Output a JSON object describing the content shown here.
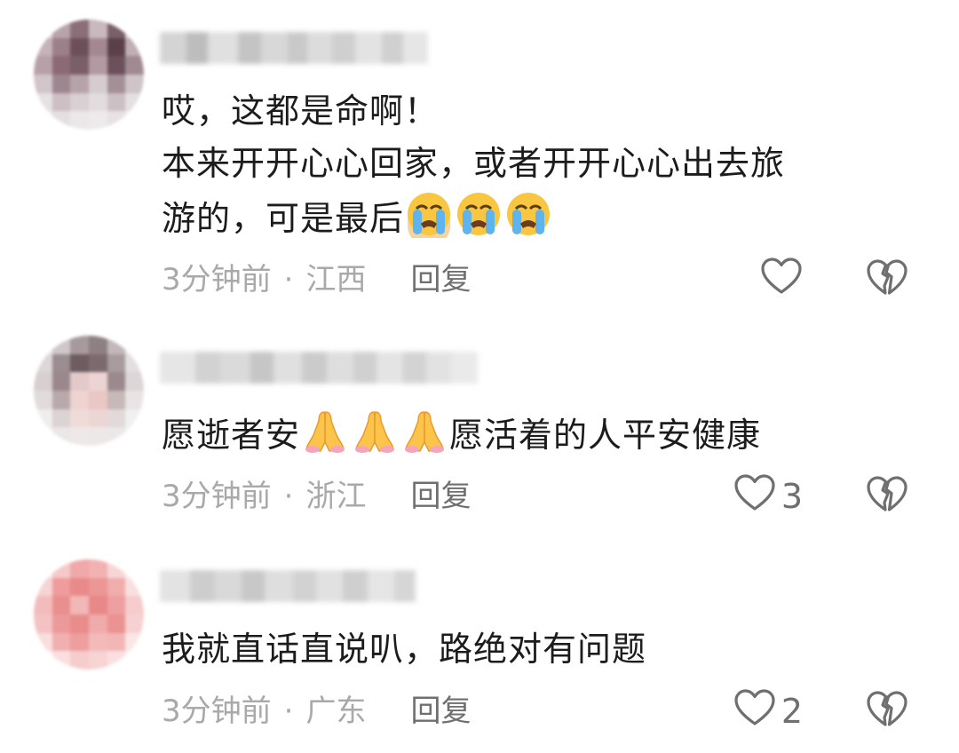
{
  "comments": [
    {
      "text_lines": [
        "哎，这都是命啊！",
        "本来开开心心回家，或者开开心心出去旅",
        "游的，可是最后"
      ],
      "time": "3分钟前",
      "separator": "·",
      "location": "江西",
      "reply_label": "回复",
      "likes": null,
      "emoji": "loudly-crying-face",
      "emoji_count": 3
    },
    {
      "text_before": "愿逝者安",
      "text_after": "愿活着的人平安健康",
      "time": "3分钟前",
      "separator": "·",
      "location": "浙江",
      "reply_label": "回复",
      "likes": "3",
      "emoji": "folded-hands",
      "emoji_count": 3
    },
    {
      "text": "我就直话直说叭，路绝对有问题",
      "time": "3分钟前",
      "separator": "·",
      "location": "广东",
      "reply_label": "回复",
      "likes": "2"
    }
  ],
  "icons": {
    "like": "heart-outline-icon",
    "dislike": "broken-heart-icon"
  },
  "colors": {
    "text": "#1c1c1c",
    "meta": "#a9a9a9",
    "icon": "#6f6f6f"
  }
}
